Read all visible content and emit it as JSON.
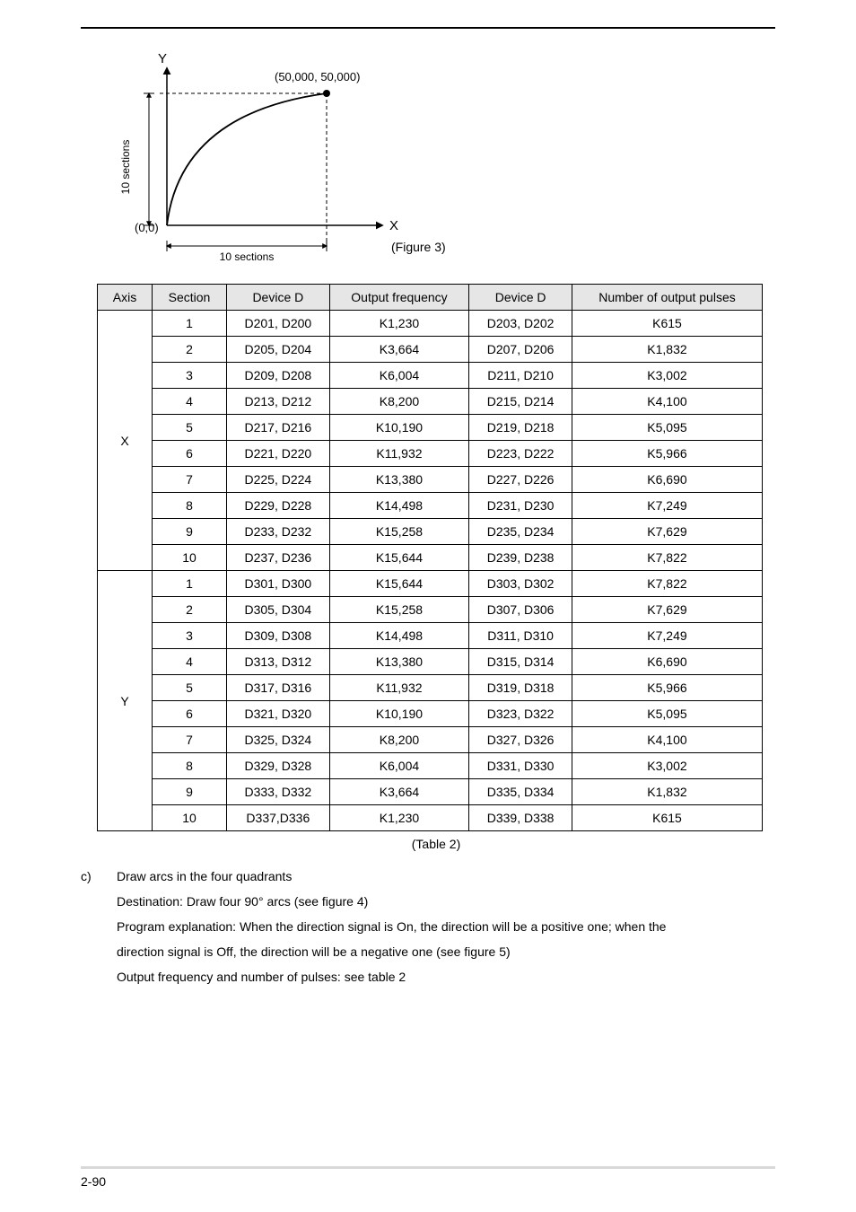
{
  "figure": {
    "y_label": "Y",
    "x_label": "X",
    "origin_label": "(0,0)",
    "point_label": "(50,000, 50,000)",
    "x_sections_label": "10 sections",
    "y_sections_label": "10 sections",
    "caption": "(Figure 3)"
  },
  "table": {
    "headers": {
      "axis": "Axis",
      "section": "Section",
      "device_d1": "Device D",
      "output_freq": "Output frequency",
      "device_d2": "Device D",
      "pulses": "Number of output pulses"
    },
    "x_label": "X",
    "y_label": "Y",
    "x_rows": [
      {
        "section": "1",
        "d1": "D201, D200",
        "freq": "K1,230",
        "d2": "D203, D202",
        "pulses": "K615"
      },
      {
        "section": "2",
        "d1": "D205, D204",
        "freq": "K3,664",
        "d2": "D207, D206",
        "pulses": "K1,832"
      },
      {
        "section": "3",
        "d1": "D209, D208",
        "freq": "K6,004",
        "d2": "D211, D210",
        "pulses": "K3,002"
      },
      {
        "section": "4",
        "d1": "D213, D212",
        "freq": "K8,200",
        "d2": "D215, D214",
        "pulses": "K4,100"
      },
      {
        "section": "5",
        "d1": "D217, D216",
        "freq": "K10,190",
        "d2": "D219, D218",
        "pulses": "K5,095"
      },
      {
        "section": "6",
        "d1": "D221, D220",
        "freq": "K11,932",
        "d2": "D223, D222",
        "pulses": "K5,966"
      },
      {
        "section": "7",
        "d1": "D225, D224",
        "freq": "K13,380",
        "d2": "D227, D226",
        "pulses": "K6,690"
      },
      {
        "section": "8",
        "d1": "D229, D228",
        "freq": "K14,498",
        "d2": "D231, D230",
        "pulses": "K7,249"
      },
      {
        "section": "9",
        "d1": "D233, D232",
        "freq": "K15,258",
        "d2": "D235, D234",
        "pulses": "K7,629"
      },
      {
        "section": "10",
        "d1": "D237, D236",
        "freq": "K15,644",
        "d2": "D239, D238",
        "pulses": "K7,822"
      }
    ],
    "y_rows": [
      {
        "section": "1",
        "d1": "D301, D300",
        "freq": "K15,644",
        "d2": "D303, D302",
        "pulses": "K7,822"
      },
      {
        "section": "2",
        "d1": "D305, D304",
        "freq": "K15,258",
        "d2": "D307, D306",
        "pulses": "K7,629"
      },
      {
        "section": "3",
        "d1": "D309, D308",
        "freq": "K14,498",
        "d2": "D311, D310",
        "pulses": "K7,249"
      },
      {
        "section": "4",
        "d1": "D313, D312",
        "freq": "K13,380",
        "d2": "D315, D314",
        "pulses": "K6,690"
      },
      {
        "section": "5",
        "d1": "D317, D316",
        "freq": "K11,932",
        "d2": "D319, D318",
        "pulses": "K5,966"
      },
      {
        "section": "6",
        "d1": "D321, D320",
        "freq": "K10,190",
        "d2": "D323, D322",
        "pulses": "K5,095"
      },
      {
        "section": "7",
        "d1": "D325, D324",
        "freq": "K8,200",
        "d2": "D327, D326",
        "pulses": "K4,100"
      },
      {
        "section": "8",
        "d1": "D329, D328",
        "freq": "K6,004",
        "d2": "D331, D330",
        "pulses": "K3,002"
      },
      {
        "section": "9",
        "d1": "D333, D332",
        "freq": "K3,664",
        "d2": "D335, D334",
        "pulses": "K1,832"
      },
      {
        "section": "10",
        "d1": "D337,D336",
        "freq": "K1,230",
        "d2": "D339, D338",
        "pulses": "K615"
      }
    ],
    "caption": "(Table 2)"
  },
  "text": {
    "c_label": "c)",
    "c_title": "Draw arcs in the four quadrants",
    "dest": "Destination: Draw four 90° arcs (see figure 4)",
    "prog1": "Program explanation: When the direction signal is On, the direction will be a positive one; when the",
    "prog2": "direction signal is Off, the direction will be a negative one (see figure 5)",
    "out": "Output frequency and number of pulses: see table 2"
  },
  "footer": {
    "page": "2-90"
  },
  "chart_data": {
    "type": "line",
    "title": "Quarter-arc trajectory (10×10 sections)",
    "x": [
      0,
      50000
    ],
    "y": [
      0,
      50000
    ],
    "xlim": [
      0,
      50000
    ],
    "ylim": [
      0,
      50000
    ],
    "annotations": [
      "(0,0)",
      "(50,000, 50,000)",
      "10 sections",
      "10 sections"
    ],
    "description": "Arc from (0,0) rising to (50000,50000) over a 10x10 section grid, quarter-circle shape."
  }
}
